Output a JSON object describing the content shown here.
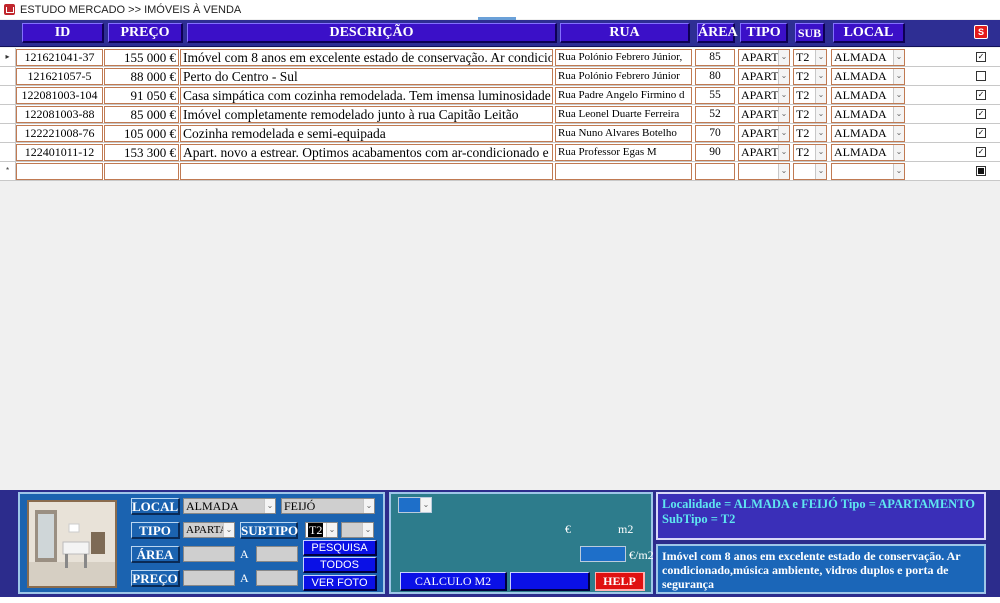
{
  "window": {
    "title": "ESTUDO MERCADO >> IMÓVEIS À VENDA"
  },
  "columns": {
    "id": "ID",
    "preco": "PREÇO",
    "descricao": "DESCRIÇÃO",
    "rua": "RUA",
    "area": "ÁREA",
    "tipo": "TIPO",
    "sub": "SUB",
    "local": "LOCAL",
    "s": "S"
  },
  "rows": [
    {
      "id": "121621041-37",
      "preco": "155 000 €",
      "descricao": "Imóvel com 8 anos em excelente estado de conservação. Ar condicionado",
      "rua": "Rua Polónio Febrero Júnior,",
      "area": "85",
      "tipo": "APART",
      "sub": "T2",
      "local": "ALMADA",
      "checked": true,
      "marker": "▸"
    },
    {
      "id": "121621057-5",
      "preco": "88 000 €",
      "descricao": "Perto do Centro - Sul",
      "rua": "Rua Polónio Febrero Júnior",
      "area": "80",
      "tipo": "APART",
      "sub": "T2",
      "local": "ALMADA",
      "checked": false,
      "marker": ""
    },
    {
      "id": "122081003-104",
      "preco": "91 050 €",
      "descricao": "Casa simpática com cozinha remodelada. Tem imensa luminosidade",
      "rua": "Rua Padre Angelo Firmino d",
      "area": "55",
      "tipo": "APART",
      "sub": "T2",
      "local": "ALMADA",
      "checked": true,
      "marker": ""
    },
    {
      "id": "122081003-88",
      "preco": "85 000 €",
      "descricao": "Imóvel completamente remodelado junto à rua Capitão Leitão",
      "rua": "Rua Leonel Duarte Ferreira",
      "area": "52",
      "tipo": "APART",
      "sub": "T2",
      "local": "ALMADA",
      "checked": true,
      "marker": ""
    },
    {
      "id": "122221008-76",
      "preco": "105 000 €",
      "descricao": "Cozinha remodelada e semi-equipada",
      "rua": "Rua Nuno Alvares Botelho",
      "area": "70",
      "tipo": "APART",
      "sub": "T2",
      "local": "ALMADA",
      "checked": true,
      "marker": ""
    },
    {
      "id": "122401011-12",
      "preco": "153 300 €",
      "descricao": "Apart. novo a estrear. Optimos acabamentos com ar-condicionado e",
      "rua": "Rua Professor Egas M",
      "area": "90",
      "tipo": "APART",
      "sub": "T2",
      "local": "ALMADA",
      "checked": true,
      "marker": ""
    }
  ],
  "new_row_marker": "*",
  "search": {
    "local_label": "LOCAL",
    "local_value": "ALMADA",
    "local2_value": "FEIJÓ",
    "tipo_label": "TIPO",
    "tipo_value": "APARTA",
    "subtipo_label": "SUBTIPO",
    "subtipo_value": "T2",
    "area_label": "ÁREA",
    "preco_label": "PREÇO",
    "a_label": "A",
    "pesquisa": "PESQUISA",
    "todos": "TODOS",
    "ver_foto": "VER FOTO"
  },
  "calc": {
    "euro": "€",
    "m2": "m2",
    "eur_per_m2": "€/m2",
    "calculo": "CALCULO M2",
    "help": "HELP"
  },
  "summary": "Localidade = ALMADA e FEIJÓ Tipo = APARTAMENTO SubTipo = T2",
  "detail": "Imóvel com 8 anos em excelente estado de conservação. Ar condicionado,música ambiente, vidros duplos e porta de segurança",
  "icons": {
    "dropdown": "chevron-down-icon",
    "checkbox": "checkbox-icon",
    "app": "access-form-icon"
  }
}
